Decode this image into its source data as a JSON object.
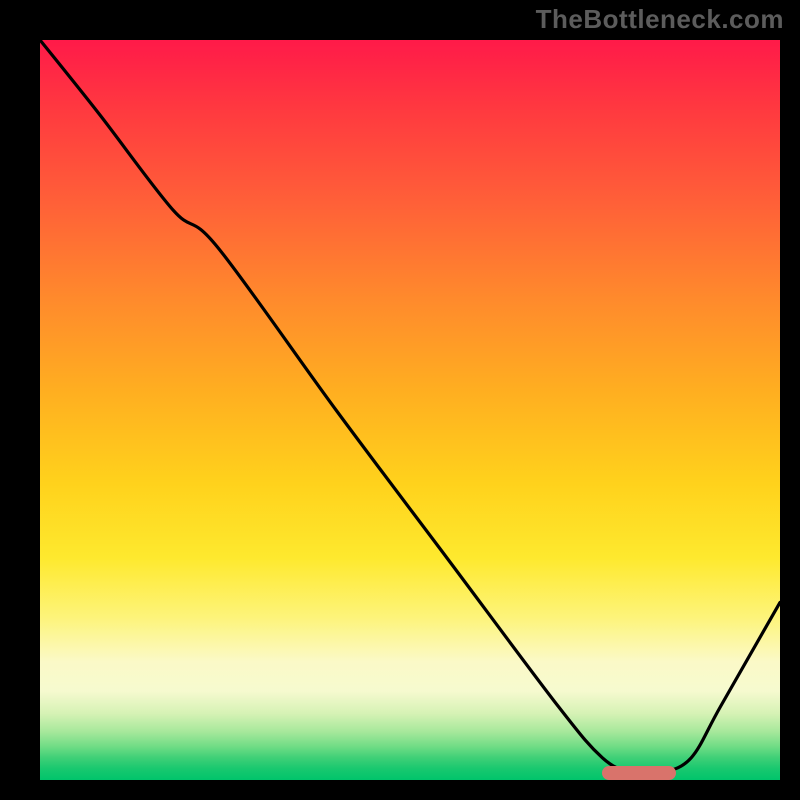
{
  "watermark": "TheBottleneck.com",
  "colors": {
    "frame_bg": "#000000",
    "watermark_text": "#5c5c5c",
    "curve_stroke": "#000000",
    "marker_fill": "#d9736b",
    "gradient_top": "#ff1a49",
    "gradient_bottom": "#00c46b"
  },
  "chart_data": {
    "type": "line",
    "title": "",
    "xlabel": "",
    "ylabel": "",
    "xlim": [
      0,
      100
    ],
    "ylim": [
      0,
      100
    ],
    "series": [
      {
        "name": "bottleneck-curve",
        "x": [
          0,
          8,
          18,
          24,
          40,
          55,
          70,
          76,
          80,
          84,
          88,
          92,
          100
        ],
        "values": [
          100,
          90,
          77,
          72,
          50,
          30,
          10,
          3,
          1,
          1,
          3,
          10,
          24
        ]
      }
    ],
    "marker": {
      "x_start": 76,
      "x_end": 86,
      "y": 1
    },
    "annotations": []
  }
}
